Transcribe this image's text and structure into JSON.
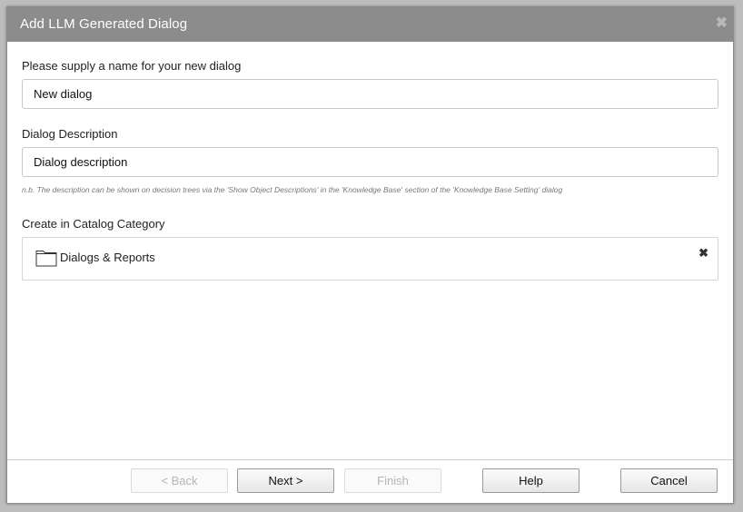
{
  "dialog": {
    "title": "Add LLM Generated Dialog",
    "close_glyph": "✖"
  },
  "form": {
    "name_label": "Please supply a name for your new dialog",
    "name_value": "New dialog",
    "description_label": "Dialog Description",
    "description_value": "Dialog description",
    "description_note": "n.b. The description can be shown on decision trees via the 'Show Object Descriptions' in the 'Knowledge Base' section of the 'Knowledge Base Setting' dialog",
    "category_label": "Create in Catalog Category",
    "category_value": "Dialogs & Reports",
    "category_icon": "folder-icon",
    "clear_glyph": "✖"
  },
  "buttons": {
    "back": "< Back",
    "next": "Next >",
    "finish": "Finish",
    "help": "Help",
    "cancel": "Cancel"
  },
  "colors": {
    "titlebar": "#8c8c8c",
    "disabled_text": "#b5b5b5"
  }
}
